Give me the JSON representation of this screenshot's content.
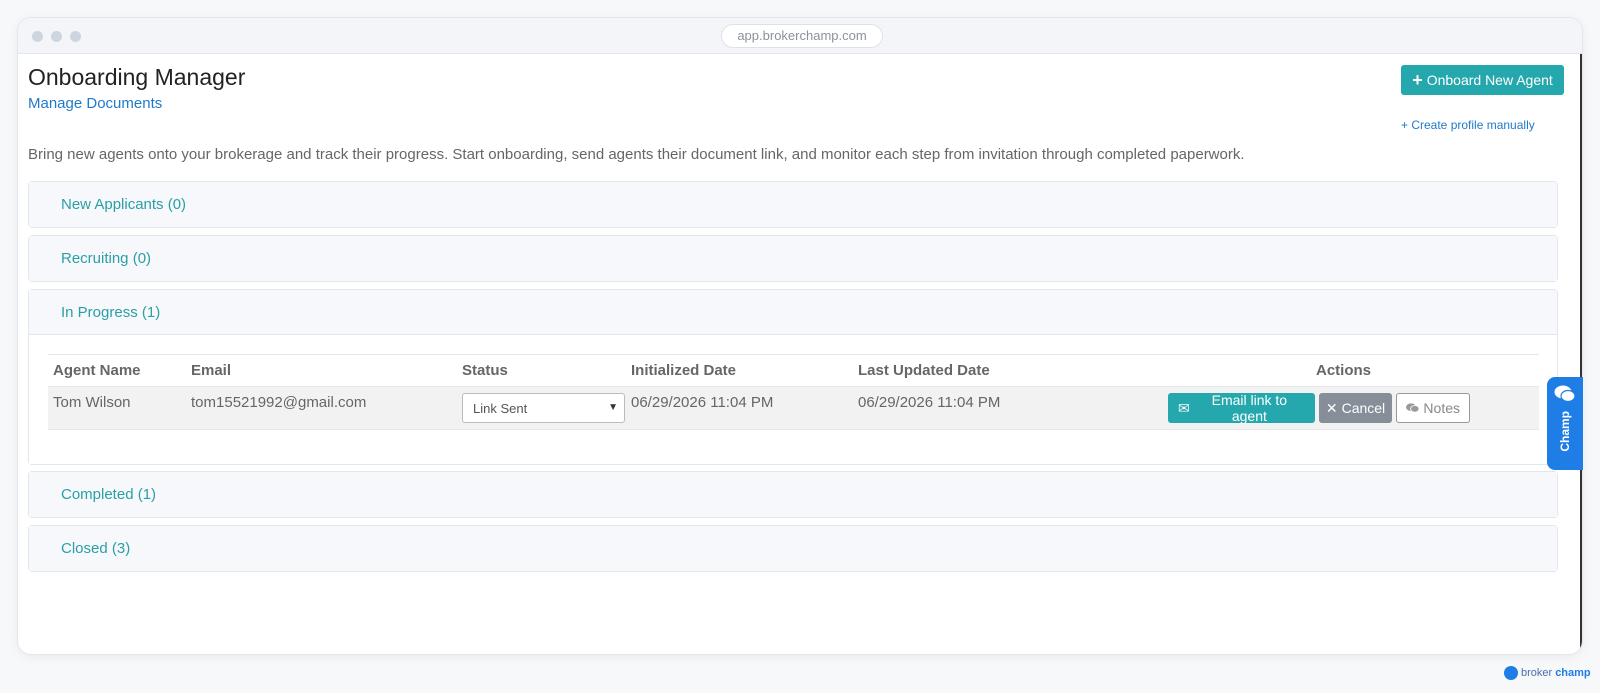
{
  "browser": {
    "url": "app.brokerchamp.com"
  },
  "header": {
    "title": "Onboarding Manager",
    "manage_link": "Manage Documents",
    "onboard_button": "Onboard New Agent",
    "create_link": "+ Create profile manually",
    "description": "Bring new agents onto your brokerage and track their progress. Start onboarding, send agents their document link, and monitor each step from invitation through completed paperwork."
  },
  "sections": [
    {
      "label": "New Applicants (0)"
    },
    {
      "label": "Recruiting (0)"
    },
    {
      "label": "In Progress (1)"
    },
    {
      "label": "Completed (1)"
    },
    {
      "label": "Closed (3)"
    }
  ],
  "table": {
    "headers": [
      "Agent Name",
      "Email",
      "Status",
      "Initialized Date",
      "Last Updated Date",
      "Actions"
    ],
    "rows": [
      {
        "name": "Tom Wilson",
        "email": "tom15521992@gmail.com",
        "status": "Link Sent",
        "initialized": "06/29/2026 11:04 PM",
        "updated": "06/29/2026 11:04 PM"
      }
    ],
    "actions": {
      "email": "Email link to agent",
      "cancel": "Cancel",
      "notes": "Notes"
    }
  },
  "chat": {
    "label": "Champ"
  },
  "footer": {
    "brand_a": "broker",
    "brand_b": "champ"
  },
  "colors": {
    "accent": "#25a8ad",
    "link": "#1f7ac9",
    "chat": "#1f7ee6"
  }
}
